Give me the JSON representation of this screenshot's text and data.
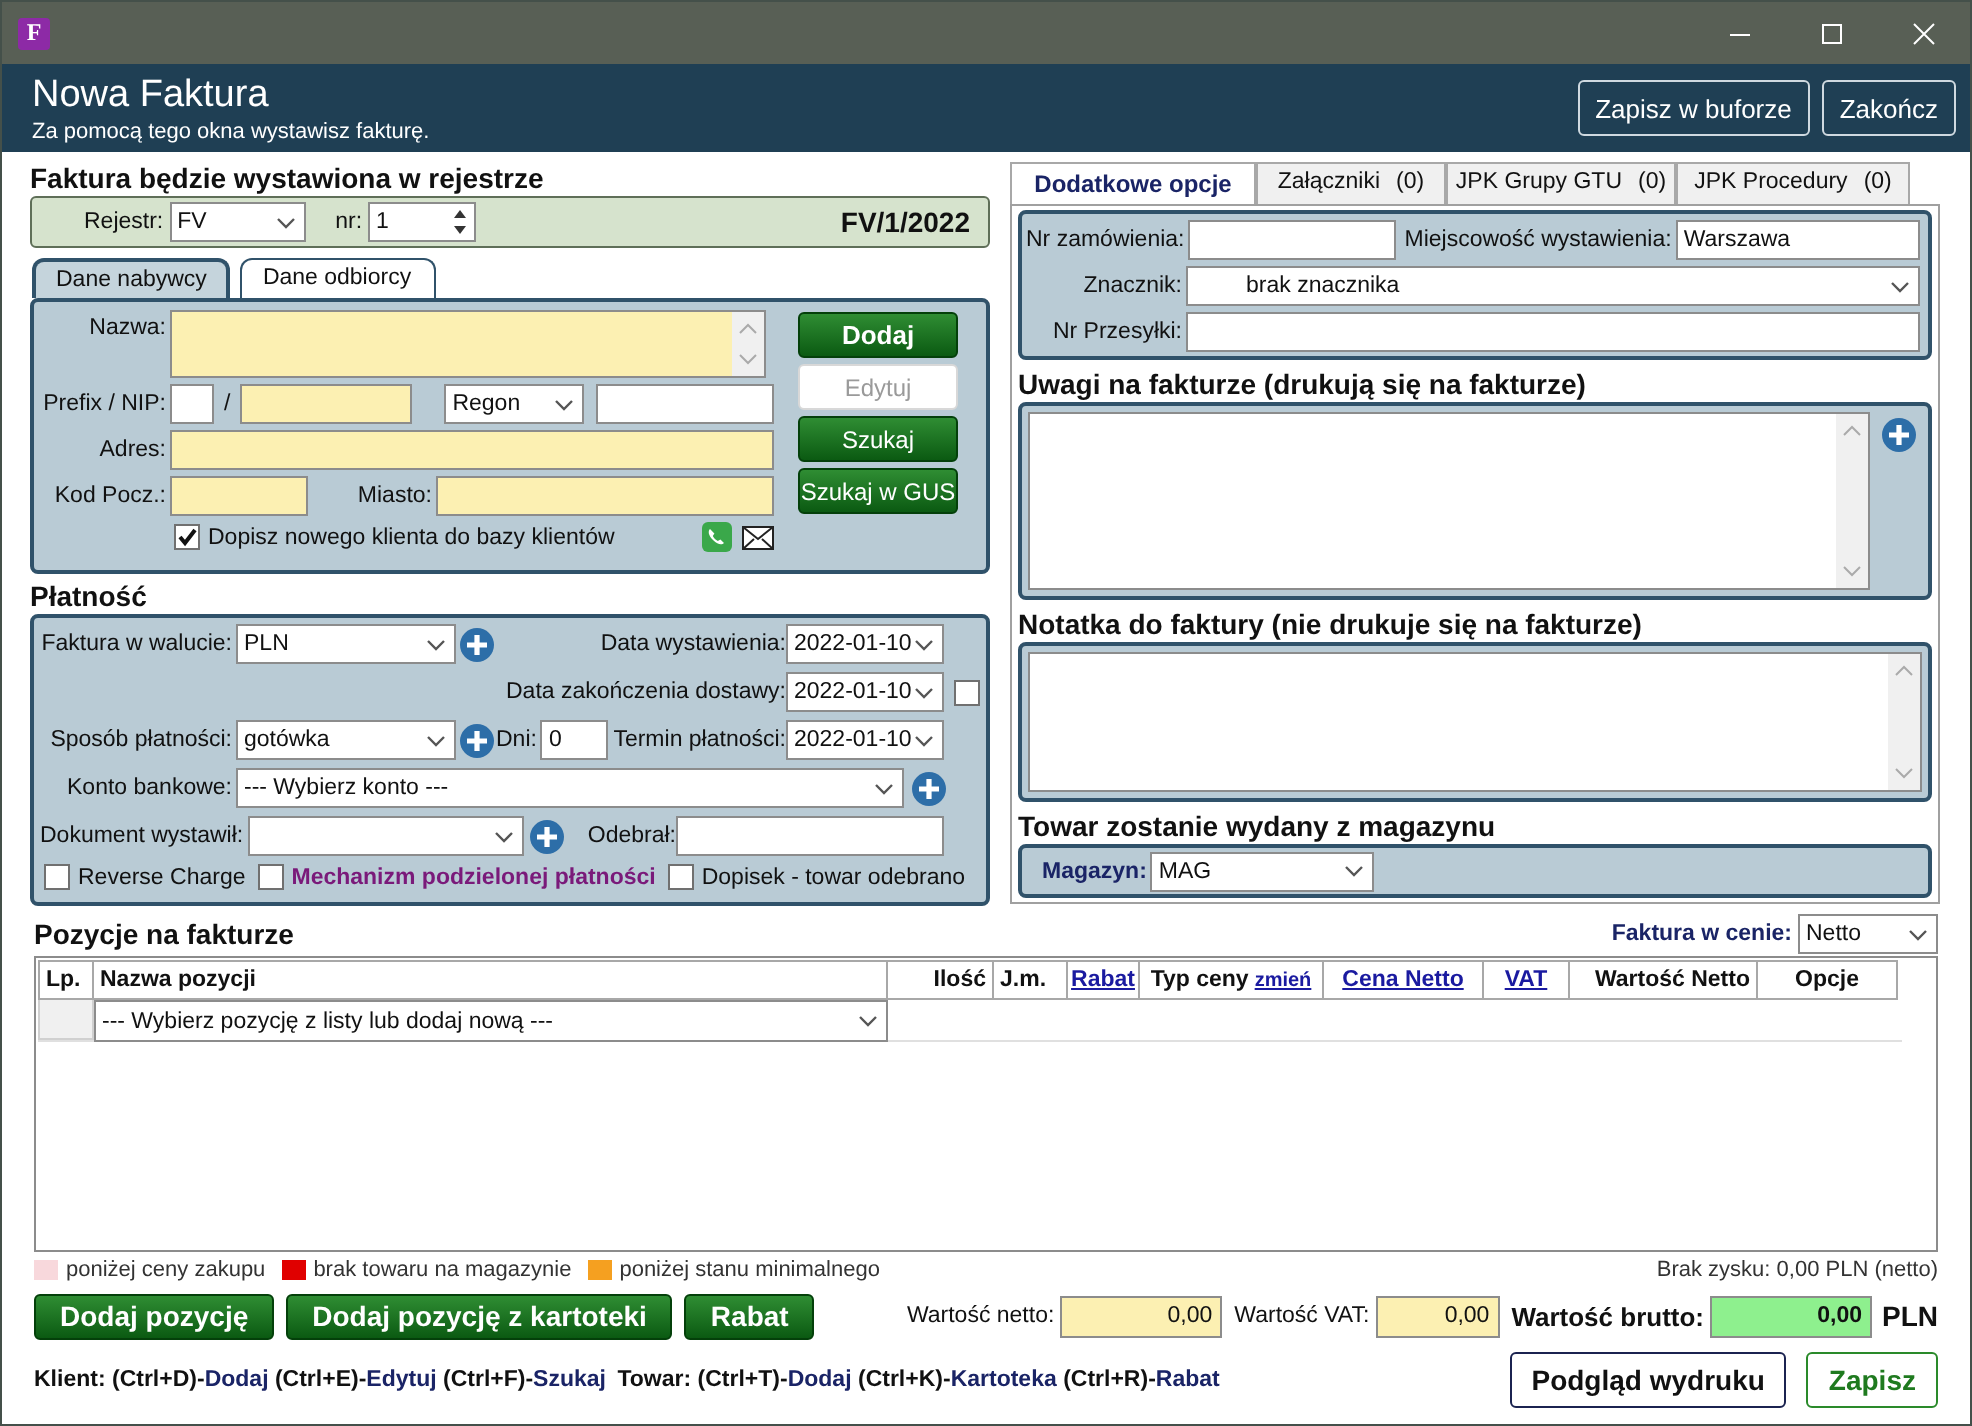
{
  "window": {
    "app_icon": "F"
  },
  "header": {
    "title": "Nowa Faktura",
    "subtitle": "Za pomocą tego okna wystawisz fakturę.",
    "buttons": [
      "Zapisz w buforze",
      "Zakończ"
    ]
  },
  "register": {
    "heading": "Faktura będzie wystawiona w rejestrze",
    "register_label": "Rejestr:",
    "register_value": "FV",
    "nr_label": "nr:",
    "nr_value": "1",
    "number": "FV/1/2022"
  },
  "party_tabs": [
    {
      "label": "Dane nabywcy",
      "selected": true
    },
    {
      "label": "Dane odbiorcy",
      "selected": false
    }
  ],
  "buyer": {
    "name_label": "Nazwa:",
    "nip_label": "Prefix / NIP:",
    "separator": "/",
    "id_type": "Regon",
    "address_label": "Adres:",
    "postal_label": "Kod Pocz.:",
    "city_label": "Miasto:",
    "add_to_clients": {
      "label": "Dopisz nowego klienta do bazy klientów",
      "checked": true
    },
    "buttons": [
      {
        "label": "Dodaj",
        "kind": "primary",
        "disabled": false
      },
      {
        "label": "Edytuj",
        "kind": "normal",
        "disabled": true
      },
      {
        "label": "Szukaj",
        "kind": "normal",
        "disabled": false
      },
      {
        "label": "Szukaj w GUS",
        "kind": "normal",
        "disabled": false
      }
    ]
  },
  "payment": {
    "heading": "Płatność",
    "currency_label": "Faktura w walucie:",
    "currency": "PLN",
    "issue_date_label": "Data wystawienia:",
    "issue_date": "2022-01-10",
    "delivery_date_label": "Data zakończenia dostawy:",
    "delivery_date": "2022-01-10",
    "delivery_date_checked": false,
    "method_label": "Sposób płatności:",
    "method": "gotówka",
    "days_label": "Dni:",
    "days": "0",
    "due_label": "Termin płatności:",
    "due": "2022-01-10",
    "account_label": "Konto bankowe:",
    "account": "--- Wybierz konto ---",
    "issuer_label": "Dokument wystawił:",
    "receiver_label": "Odebrał:",
    "options": [
      {
        "label": "Reverse Charge",
        "kind": "plain",
        "checked": false
      },
      {
        "label": "Mechanizm podzielonej płatności",
        "kind": "highlight",
        "checked": false
      },
      {
        "label": "Dopisek - towar odebrano",
        "kind": "plain",
        "checked": false
      }
    ]
  },
  "options_tabs": [
    {
      "label": "Dodatkowe opcje",
      "selected": true
    },
    {
      "label": "Załączniki",
      "count": "(0)",
      "selected": false
    },
    {
      "label": "JPK Grupy GTU",
      "count": "(0)",
      "selected": false
    },
    {
      "label": "JPK Procedury",
      "count": "(0)",
      "selected": false
    }
  ],
  "options": {
    "order_label": "Nr zamówienia:",
    "place_label": "Miejscowość wystawienia:",
    "place": "Warszawa",
    "marker_label": "Znacznik:",
    "marker": "brak znacznika",
    "shipment_label": "Nr Przesyłki:"
  },
  "notes_heading": "Uwagi na fakturze (drukują się na fakturze)",
  "internal_note_heading": "Notatka do faktury (nie drukuje się na fakturze)",
  "warehouse": {
    "heading": "Towar zostanie wydany z magazynu",
    "label": "Magazyn:",
    "value": "MAG"
  },
  "items": {
    "heading": "Pozycje na fakturze",
    "price_mode_label": "Faktura w cenie:",
    "price_mode": "Netto",
    "columns": [
      {
        "label": "Lp.",
        "kind": "text"
      },
      {
        "label": "Nazwa pozycji",
        "kind": "text"
      },
      {
        "label": "Ilość",
        "kind": "text"
      },
      {
        "label": "J.m.",
        "kind": "text"
      },
      {
        "label": "Rabat",
        "kind": "link"
      },
      {
        "label": "Typ ceny",
        "action": "zmień",
        "kind": "with_action"
      },
      {
        "label": "Cena Netto",
        "kind": "link"
      },
      {
        "label": "VAT",
        "kind": "link"
      },
      {
        "label": "Wartość Netto",
        "kind": "text"
      },
      {
        "label": "Opcje",
        "kind": "text"
      }
    ],
    "new_item_prompt": "--- Wybierz pozycję z listy lub dodaj nową ---"
  },
  "legend": [
    {
      "label": "poniżej ceny zakupu",
      "color": "#f8d8dc"
    },
    {
      "label": "brak towaru na magazynie",
      "color": "#e00000"
    },
    {
      "label": "poniżej stanu minimalnego",
      "color": "#f5a020"
    }
  ],
  "profit_note": "Brak zysku: 0,00 PLN (netto)",
  "item_buttons": [
    "Dodaj pozycję",
    "Dodaj pozycję z kartoteki",
    "Rabat"
  ],
  "totals": [
    {
      "label": "Wartość netto:",
      "value": "0,00",
      "kind": "normal"
    },
    {
      "label": "Wartość VAT:",
      "value": "0,00",
      "kind": "normal"
    },
    {
      "label": "Wartość brutto:",
      "value": "0,00",
      "kind": "total"
    }
  ],
  "currency": "PLN",
  "shortcuts": [
    {
      "label": "Klient:",
      "items": [
        {
          "key": "(Ctrl+D)-",
          "action": "Dodaj"
        },
        {
          "key": "(Ctrl+E)-",
          "action": "Edytuj"
        },
        {
          "key": "(Ctrl+F)-",
          "action": "Szukaj"
        }
      ]
    },
    {
      "label": "Towar:",
      "items": [
        {
          "key": "(Ctrl+T)-",
          "action": "Dodaj"
        },
        {
          "key": "(Ctrl+K)-",
          "action": "Kartoteka"
        },
        {
          "key": "(Ctrl+R)-",
          "action": "Rabat"
        }
      ]
    }
  ],
  "footer_buttons": [
    {
      "label": "Podgląd wydruku",
      "kind": "normal"
    },
    {
      "label": "Zapisz",
      "kind": "confirm"
    }
  ]
}
